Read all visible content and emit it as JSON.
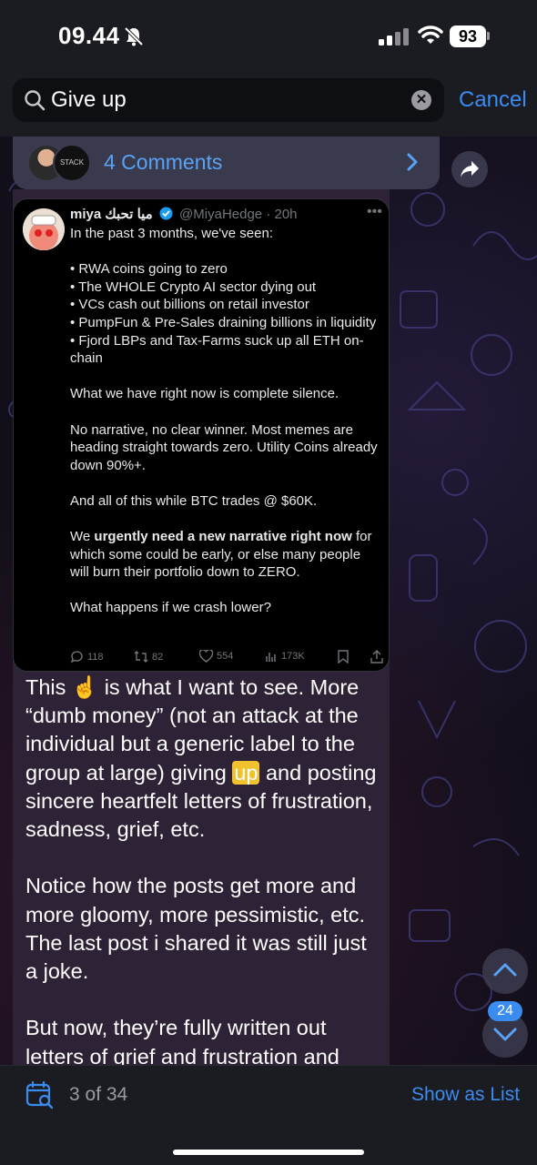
{
  "status_bar": {
    "time": "09.44",
    "battery": "93"
  },
  "search": {
    "query": "Give up",
    "placeholder": "Search",
    "cancel_label": "Cancel"
  },
  "comments_bar": {
    "label": "4 Comments",
    "avatar_text": "STACK"
  },
  "tweet": {
    "name": "miya",
    "arabic_name": "ميا تحبك",
    "handle": "@MiyaHedge",
    "time": "· 20h",
    "lines": {
      "intro": "In the past 3 months, we've seen:",
      "b1": "• RWA coins going to zero",
      "b2": "• The WHOLE Crypto AI sector dying out",
      "b3": "• VCs cash out billions on retail investor",
      "b4": "• PumpFun & Pre-Sales draining billions in liquidity",
      "b5": "• Fjord LBPs and Tax-Farms suck up all ETH on-chain",
      "p1": "What we have right now is complete silence.",
      "p2": "No narrative, no clear winner. Most memes are heading straight towards zero. Utility Coins already down 90%+.",
      "p3": "And all of this while BTC trades @ $60K.",
      "p4_a": "We ",
      "p4_bold": "urgently need a new narrative right now",
      "p4_b": " for which some could be early, or else many people will burn their portfolio down to ZERO.",
      "p5": "What happens if we crash lower?"
    },
    "stats": {
      "replies": "118",
      "retweets": "82",
      "likes": "554",
      "views": "173K"
    }
  },
  "reply": {
    "p1_a": "This ☝️ is what I want to see. More “dumb money” (not an attack at the individual but a generic label to the group at large) giving ",
    "p1_highlight": "up",
    "p1_b": " and posting sincere heartfelt letters of frustration, sadness, grief, etc.",
    "p2": "Notice how the posts get more and more gloomy, more pessimistic, etc. The last post i shared it was still just a joke.",
    "p3": "But now, they’re fully written out letters of grief and frustration and"
  },
  "nav": {
    "unread_count": "24"
  },
  "bottom_bar": {
    "counter": "3 of 34",
    "show_as_list": "Show as List"
  },
  "colors": {
    "accent": "#3a8cf0",
    "highlight": "#f2c12e",
    "bubble": "#2e2336"
  }
}
